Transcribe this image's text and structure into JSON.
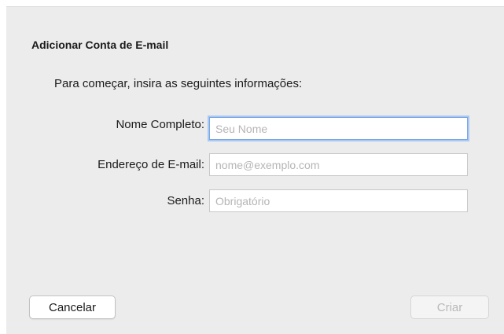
{
  "dialog": {
    "title": "Adicionar Conta de E-mail",
    "intro": "Para começar, insira as seguintes informações:"
  },
  "form": {
    "full_name": {
      "label": "Nome Completo:",
      "placeholder": "Seu Nome",
      "value": ""
    },
    "email": {
      "label": "Endereço de E-mail:",
      "placeholder": "nome@exemplo.com",
      "value": ""
    },
    "password": {
      "label": "Senha:",
      "placeholder": "Obrigatório",
      "value": ""
    }
  },
  "buttons": {
    "cancel_label": "Cancelar",
    "create_label": "Criar",
    "create_enabled": false
  },
  "colors": {
    "sheet_background": "#ececec",
    "focus_ring": "#7aa7e6",
    "placeholder_text": "#b5b5b5",
    "disabled_text": "#b8b8b8"
  }
}
